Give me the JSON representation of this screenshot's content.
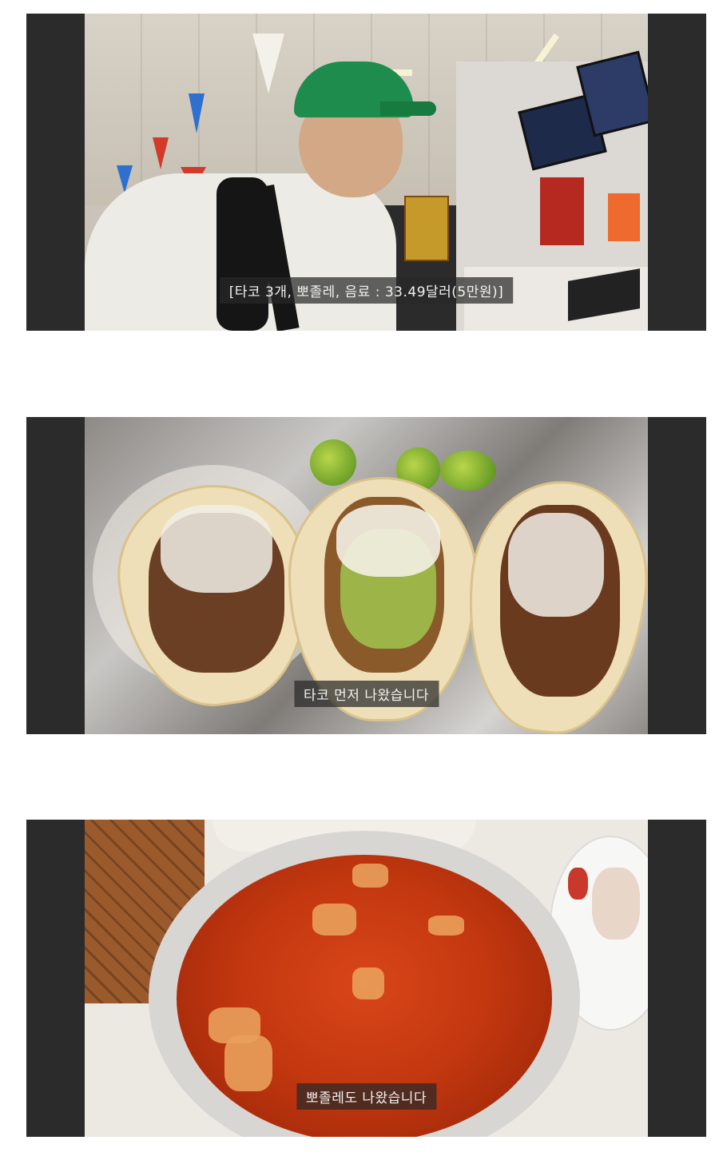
{
  "panels": [
    {
      "id": "restaurant",
      "caption": "[타코 3개, 뽀졸레, 음료 : 33.49달러(5만원)]"
    },
    {
      "id": "tacos",
      "caption": "타코 먼저 나왔습니다"
    },
    {
      "id": "pozole",
      "caption": "뽀졸레도 나왔습니다"
    }
  ],
  "colors": {
    "panel_frame": "#2b2b2b",
    "caption_bg": "rgba(40,40,40,0.72)",
    "caption_text": "#f2f2f2",
    "cap_green": "#1e8c4c",
    "soup_red": "#c4380f"
  }
}
